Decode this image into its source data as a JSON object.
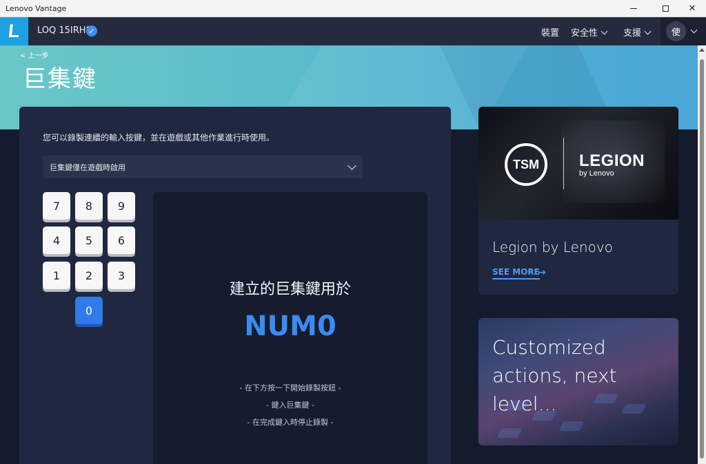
{
  "window": {
    "title": "Lenovo Vantage"
  },
  "nav": {
    "logo_letter": "L",
    "device_name": "LOQ 15IRH8",
    "links": {
      "device": "裝置",
      "security": "安全性",
      "support": "支援"
    },
    "user_initial": "使"
  },
  "page": {
    "back": "< 上一步",
    "title": "巨集鍵",
    "description": "您可以錄製連續的輸入按鍵，並在遊戲或其他作業進行時使用。",
    "mode_select": {
      "value": "巨集鍵僅在遊戲時啟用"
    }
  },
  "keypad": {
    "keys": [
      "7",
      "8",
      "9",
      "4",
      "5",
      "6",
      "1",
      "2",
      "3",
      "0"
    ],
    "selected": "0"
  },
  "macro_panel": {
    "title": "建立的巨集鍵用於",
    "key": "NUM0",
    "steps": [
      "- 在下方按一下開始錄製按鈕 -",
      "- 鍵入巨集鍵 -",
      "- 在完成鍵入時停止錄製 -"
    ]
  },
  "promo1": {
    "tsm_logo": "TSM",
    "legion_logo": "LEGION",
    "legion_sub": "by Lenovo",
    "title": "Legion by Lenovo",
    "cta": "SEE MORE"
  },
  "promo2": {
    "text": "Customized actions, next level..."
  },
  "colors": {
    "accent": "#2f7be8",
    "logo_bg": "#1da1e0",
    "card_bg": "#1f2840",
    "panel_bg": "#141c2e"
  }
}
